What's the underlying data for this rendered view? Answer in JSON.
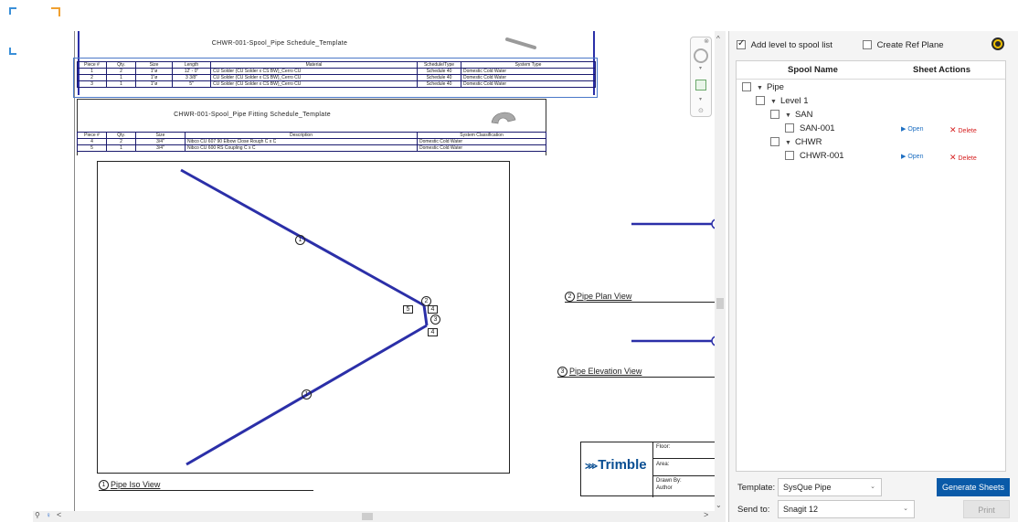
{
  "colors": {
    "accent": "#0a5aa8",
    "pipe": "#2b2fa8",
    "delete": "#d62020",
    "open": "#1e6fc2",
    "selection": "#4a78c8"
  },
  "pipe_schedule": {
    "title": "CHWR-001-Spool_Pipe Schedule_Template",
    "headers": [
      "Piece #",
      "Qty.",
      "Size",
      "Length",
      "Material",
      "Schedule/Type",
      "System Type"
    ],
    "rows": [
      [
        "1",
        "2",
        "1\"ø",
        "12' - 0\"",
        "CU Solder (CU Solder x CS BW)_Cerro CU",
        "Schedule 40",
        "Domestic Cold Water"
      ],
      [
        "2",
        "1",
        "1\"ø",
        "3 3/8\"",
        "CU Solder (CU Solder x CS BW)_Cerro CU",
        "Schedule 40",
        "Domestic Cold Water"
      ],
      [
        "3",
        "1",
        "1\"ø",
        "5\"",
        "CU Solder (CU Solder x CS BW)_Cerro CU",
        "Schedule 40",
        "Domestic Cold Water"
      ]
    ]
  },
  "fitting_schedule": {
    "title": "CHWR-001-Spool_Pipe Fitting Schedule_Template",
    "headers": [
      "Piece #",
      "Qty.",
      "Size",
      "Description",
      "System Classification"
    ],
    "rows": [
      [
        "4",
        "2",
        "3/4\"",
        "Nibco CU 607 90 Elbow Close Rough C x C",
        "Domestic Cold Water"
      ],
      [
        "5",
        "1",
        "3/4\"",
        "Nibco CU 600 RS Coupling C x C",
        "Domestic Cold Water"
      ]
    ]
  },
  "iso_view": {
    "label": "Pipe Iso View",
    "num": "1",
    "tags": {
      "one_a": "1",
      "one_b": "1",
      "two": "2",
      "three": "3",
      "four_a": "4",
      "four_b": "4",
      "five": "5"
    }
  },
  "plan_view": {
    "label": "Pipe Plan View",
    "num": "2"
  },
  "elevation_view": {
    "label": "Pipe Elevation View",
    "num": "3"
  },
  "title_block": {
    "logo": "Trimble",
    "floor_label": "Floor:",
    "area_label": "Area:",
    "drawn_label": "Drawn By:",
    "drawn_value": "Author"
  },
  "panel": {
    "add_level_label": "Add level to spool list",
    "add_level_checked": true,
    "ref_plane_label": "Create Ref Plane",
    "ref_plane_checked": false,
    "col_name": "Spool Name",
    "col_actions": "Sheet Actions",
    "tree": [
      {
        "label": "Pipe",
        "indent": 0,
        "caret": true
      },
      {
        "label": "Level 1",
        "indent": 1,
        "caret": true
      },
      {
        "label": "SAN",
        "indent": 2,
        "caret": true
      },
      {
        "label": "SAN-001",
        "indent": 3,
        "caret": false,
        "actions": true
      },
      {
        "label": "CHWR",
        "indent": 2,
        "caret": true
      },
      {
        "label": "CHWR-001",
        "indent": 3,
        "caret": false,
        "actions": true
      }
    ],
    "open_label": "Open",
    "delete_label": "Delete",
    "template_label": "Template:",
    "template_value": "SysQue Pipe",
    "generate_label": "Generate Sheets",
    "sendto_label": "Send to:",
    "sendto_value": "Snagit 12",
    "print_label": "Print"
  }
}
